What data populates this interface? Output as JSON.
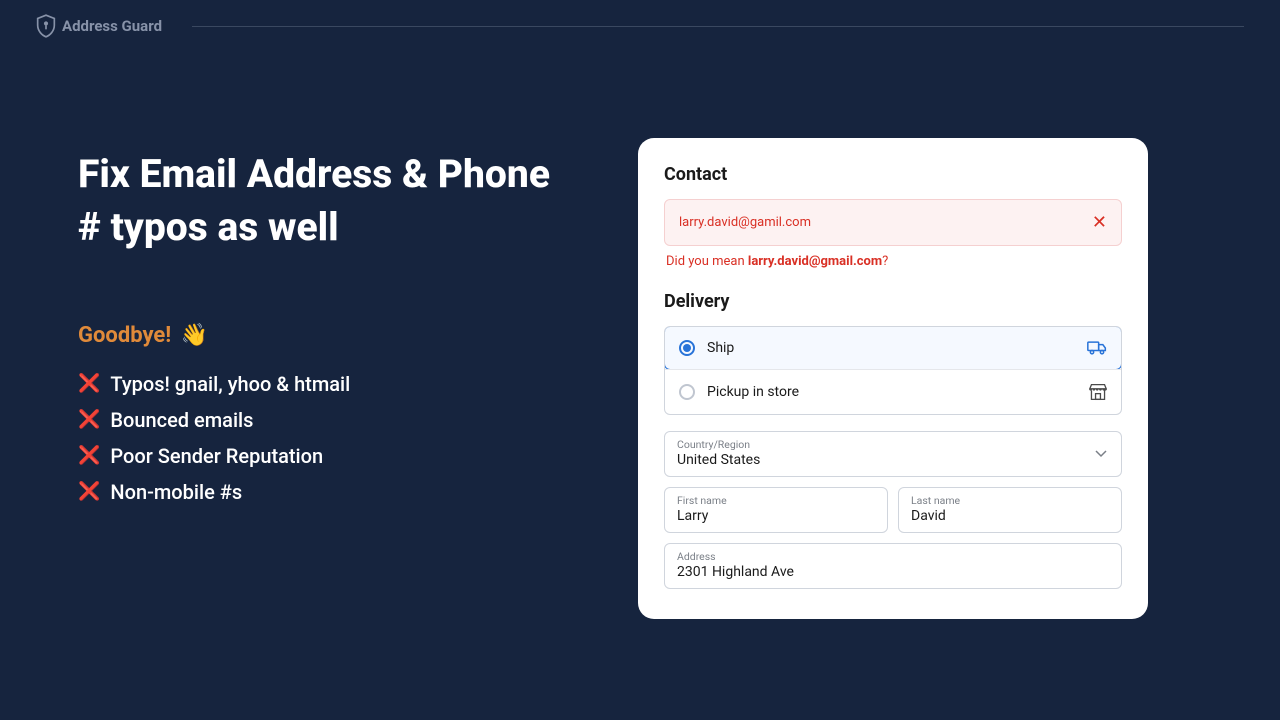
{
  "brand": "Address Guard",
  "headline": "Fix Email Address & Phone # typos as well",
  "goodbye_label": "Goodbye!",
  "goodbye_emoji": "👋",
  "bullets": [
    "Typos! gnail, yhoo & htmail",
    "Bounced emails",
    "Poor Sender Reputation",
    "Non-mobile #s"
  ],
  "form": {
    "contact_title": "Contact",
    "email_value": "larry.david@gamil.com",
    "suggestion_prefix": "Did you mean ",
    "suggestion_email": "larry.david@gmail.com",
    "suggestion_suffix": "?",
    "delivery_title": "Delivery",
    "ship_label": "Ship",
    "pickup_label": "Pickup in store",
    "country_label": "Country/Region",
    "country_value": "United States",
    "first_name_label": "First name",
    "first_name_value": "Larry",
    "last_name_label": "Last name",
    "last_name_value": "David",
    "address_label": "Address",
    "address_value": "2301 Highland Ave"
  }
}
